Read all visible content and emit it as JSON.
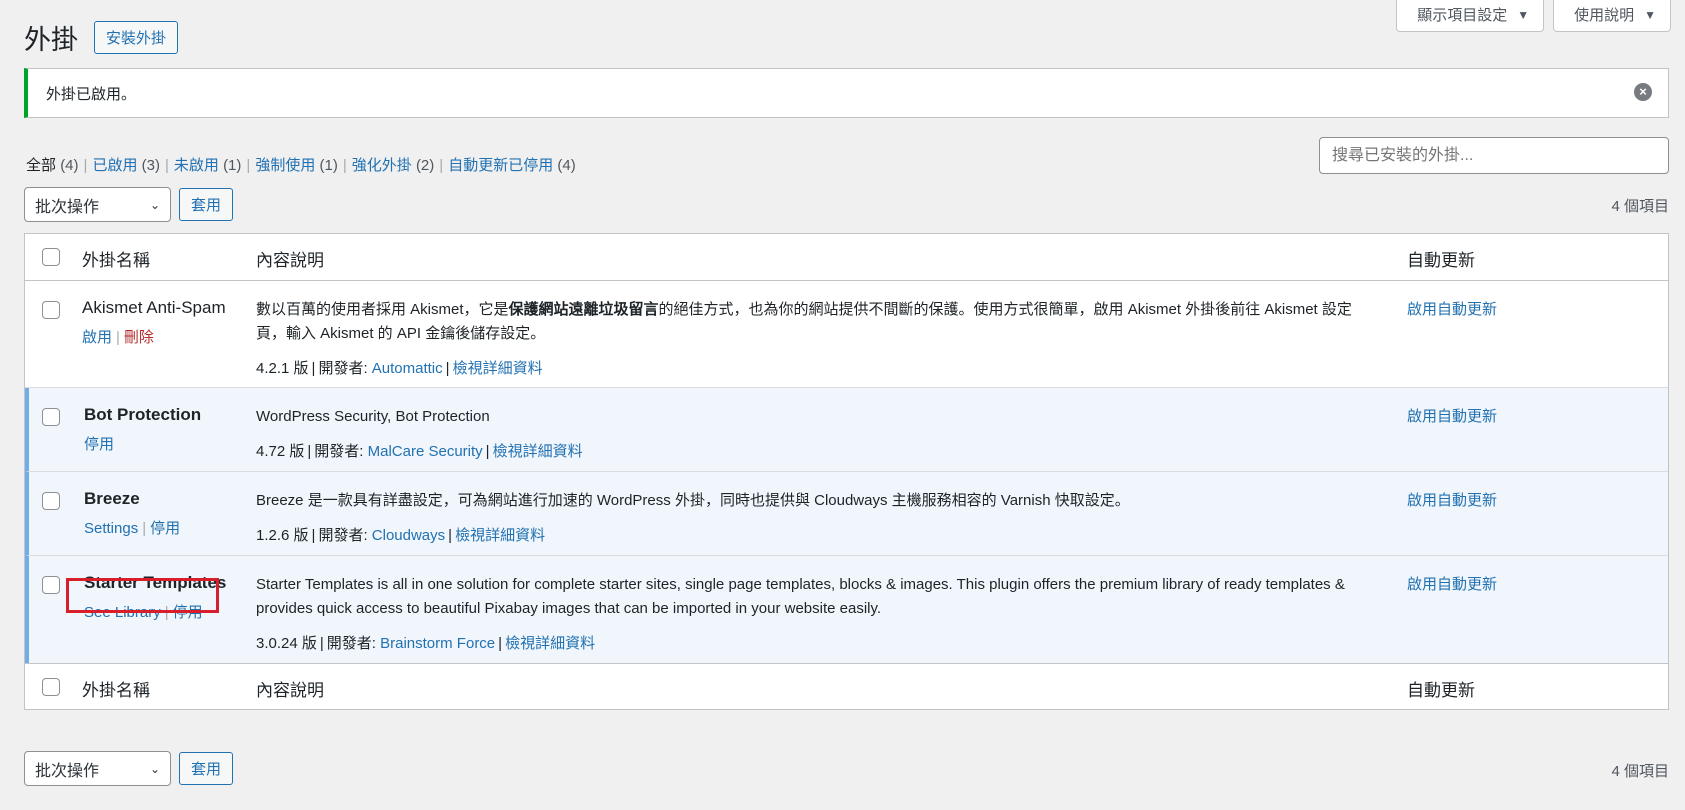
{
  "header": {
    "title": "外掛",
    "add_new": "安裝外掛",
    "screen_options": "顯示項目設定",
    "help": "使用說明"
  },
  "notice": {
    "text": "外掛已啟用。"
  },
  "filters": [
    {
      "label": "全部",
      "count": "(4)"
    },
    {
      "label": "已啟用",
      "count": "(3)"
    },
    {
      "label": "未啟用",
      "count": "(1)"
    },
    {
      "label": "強制使用",
      "count": "(1)"
    },
    {
      "label": "強化外掛",
      "count": "(2)"
    },
    {
      "label": "自動更新已停用",
      "count": "(4)"
    }
  ],
  "search": {
    "placeholder": "搜尋已安裝的外掛..."
  },
  "bulk": {
    "select_label": "批次操作",
    "apply": "套用",
    "count": "4 個項目"
  },
  "columns": {
    "name": "外掛名稱",
    "description": "內容說明",
    "auto_updates": "自動更新"
  },
  "plugins": [
    {
      "name": "Akismet Anti-Spam",
      "actions": [
        "啟用",
        "刪除"
      ],
      "desc_pre": "數以百萬的使用者採用 Akismet，它是",
      "desc_bold": "保護網站遠離垃圾留言",
      "desc_post": "的絕佳方式，也為你的網站提供不間斷的保護。使用方式很簡單，啟用 Akismet 外掛後前往 Akismet 設定頁，輸入 Akismet 的 API 金鑰後儲存設定。",
      "version": "4.2.1 版",
      "author_label": "開發者:",
      "author": "Automattic",
      "details": "檢視詳細資料",
      "auto": "啟用自動更新"
    },
    {
      "name": "Bot Protection",
      "actions": [
        "停用"
      ],
      "desc": "WordPress Security, Bot Protection",
      "version": "4.72 版",
      "author_label": "開發者:",
      "author": "MalCare Security",
      "details": "檢視詳細資料",
      "auto": "啟用自動更新"
    },
    {
      "name": "Breeze",
      "actions": [
        "Settings",
        "停用"
      ],
      "desc": "Breeze 是一款具有詳盡設定，可為網站進行加速的 WordPress 外掛，同時也提供與 Cloudways 主機服務相容的 Varnish 快取設定。",
      "version": "1.2.6 版",
      "author_label": "開發者:",
      "author": "Cloudways",
      "details": "檢視詳細資料",
      "auto": "啟用自動更新"
    },
    {
      "name": "Starter Templates",
      "actions": [
        "See Library",
        "停用"
      ],
      "desc": "Starter Templates is all in one solution for complete starter sites, single page templates, blocks & images. This plugin offers the premium library of ready templates & provides quick access to beautiful Pixabay images that can be imported in your website easily.",
      "version": "3.0.24 版",
      "author_label": "開發者:",
      "author": "Brainstorm Force",
      "details": "檢視詳細資料",
      "auto": "啟用自動更新"
    }
  ],
  "colors": {
    "accent": "#2271b1",
    "active_border": "#72aee6",
    "notice_border": "#00a32a",
    "highlight": "#d81e2a"
  }
}
